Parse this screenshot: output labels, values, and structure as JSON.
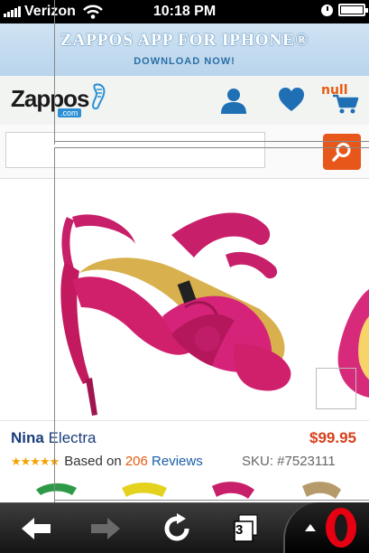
{
  "status_bar": {
    "carrier": "Verizon",
    "time": "10:18 PM"
  },
  "banner": {
    "title": "ZAPPOS APP FOR IPHONE®",
    "subtitle": "DOWNLOAD NOW!"
  },
  "header": {
    "logo_text": "Zappos",
    "logo_domain": ".com",
    "cart_count": "null"
  },
  "search": {
    "value": "",
    "placeholder": ""
  },
  "product": {
    "brand": "Nina",
    "name": "Electra",
    "price": "$99.95",
    "stars": "★★★★★",
    "reviews_prefix": "Based on",
    "review_count": "206",
    "reviews_label": "Reviews",
    "sku": "SKU: #7523111",
    "image": "pink-strappy-heel",
    "rating": 5
  },
  "toolbar": {
    "tab_count": "3"
  },
  "colors": {
    "accent": "#e85a0f",
    "link": "#1a3e7a",
    "price": "#d8401a",
    "banner": "#c4dbef"
  }
}
